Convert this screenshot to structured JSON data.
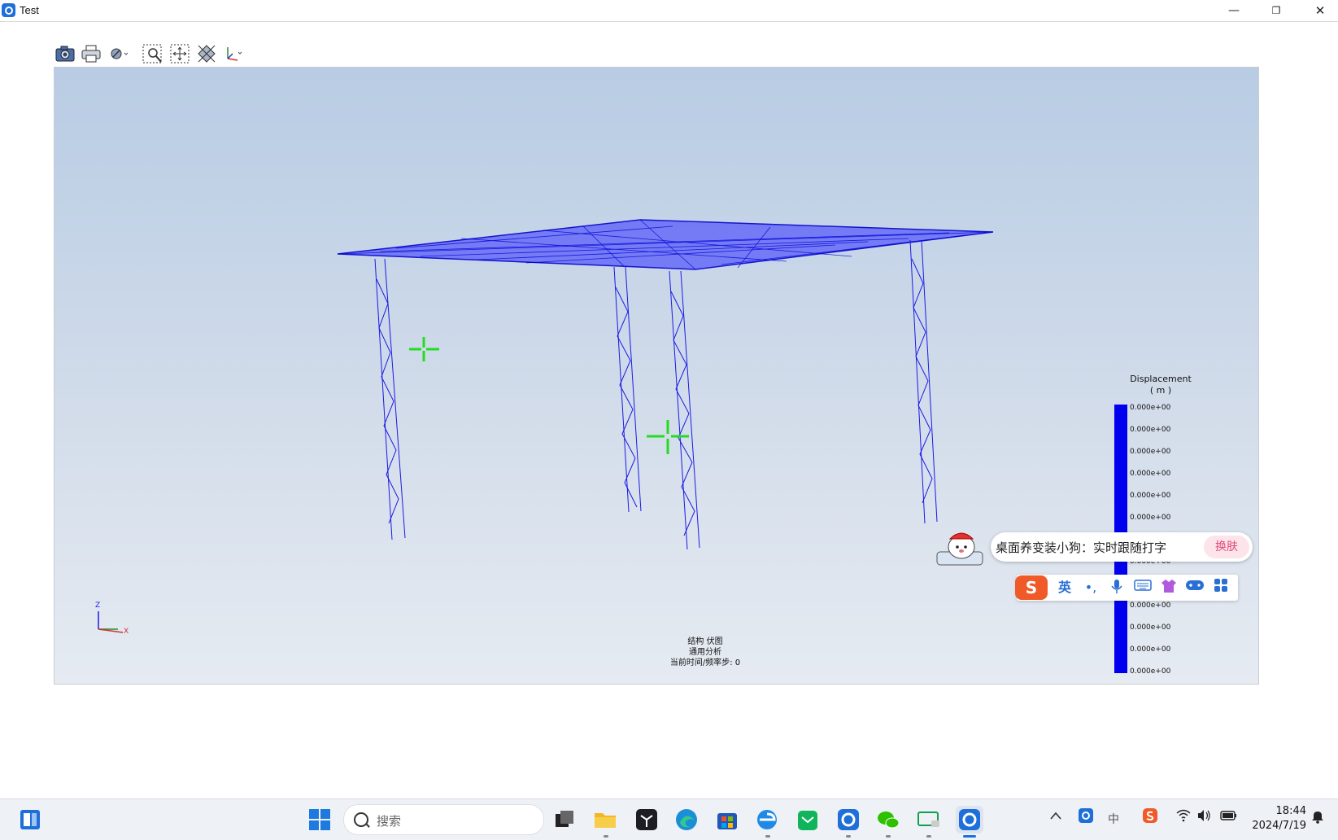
{
  "window": {
    "title": "Test",
    "minimize_glyph": "—",
    "maximize_glyph": "❐",
    "close_glyph": "✕"
  },
  "toolbar": {
    "items": [
      {
        "icon": "camera-icon"
      },
      {
        "icon": "print-icon"
      },
      {
        "icon": "render-mode-dropdown-icon"
      },
      {
        "icon": "zoom-window-icon"
      },
      {
        "icon": "fit-all-icon"
      },
      {
        "icon": "view-orientation-icon"
      },
      {
        "icon": "axis-view-dropdown-icon"
      }
    ]
  },
  "viewport": {
    "caption": [
      "结构 伏图",
      "通用分析",
      "当前时间/频率步: 0"
    ],
    "axis_labels": {
      "z": "Z",
      "x": "X"
    }
  },
  "legend": {
    "title": "Displacement",
    "unit": "( m )",
    "color": "#0000ee",
    "values": [
      "0.000e+00",
      "0.000e+00",
      "0.000e+00",
      "0.000e+00",
      "0.000e+00",
      "0.000e+00",
      "0.000e+00",
      "0.000e+00",
      "0.000e+00",
      "0.000e+00",
      "0.000e+00",
      "0.000e+00",
      "0.000e+00"
    ]
  },
  "ime": {
    "popup_text": "桌面养变装小狗：实时跟随打字",
    "skin_button": "换肤",
    "bar": [
      "S",
      "英",
      "•,",
      "mic",
      "keyboard",
      "shirt",
      "gamepad",
      "apps"
    ]
  },
  "taskbar": {
    "search_placeholder": "搜索",
    "apps": [
      "widgets-icon",
      "start-icon",
      "task-view-icon",
      "file-explorer-icon",
      "terminal-icon",
      "edge-icon",
      "store-icon",
      "ie-icon",
      "mail-icon",
      "app-icon",
      "wechat-icon",
      "remote-icon",
      "test-app-icon"
    ],
    "tray": {
      "ime_mode": "中",
      "time": "18:44",
      "date": "2024/7/19"
    }
  },
  "colors": {
    "mesh": "#1a1ae6",
    "accent": "#1e6fd9",
    "crosshair": "#22dd22"
  }
}
